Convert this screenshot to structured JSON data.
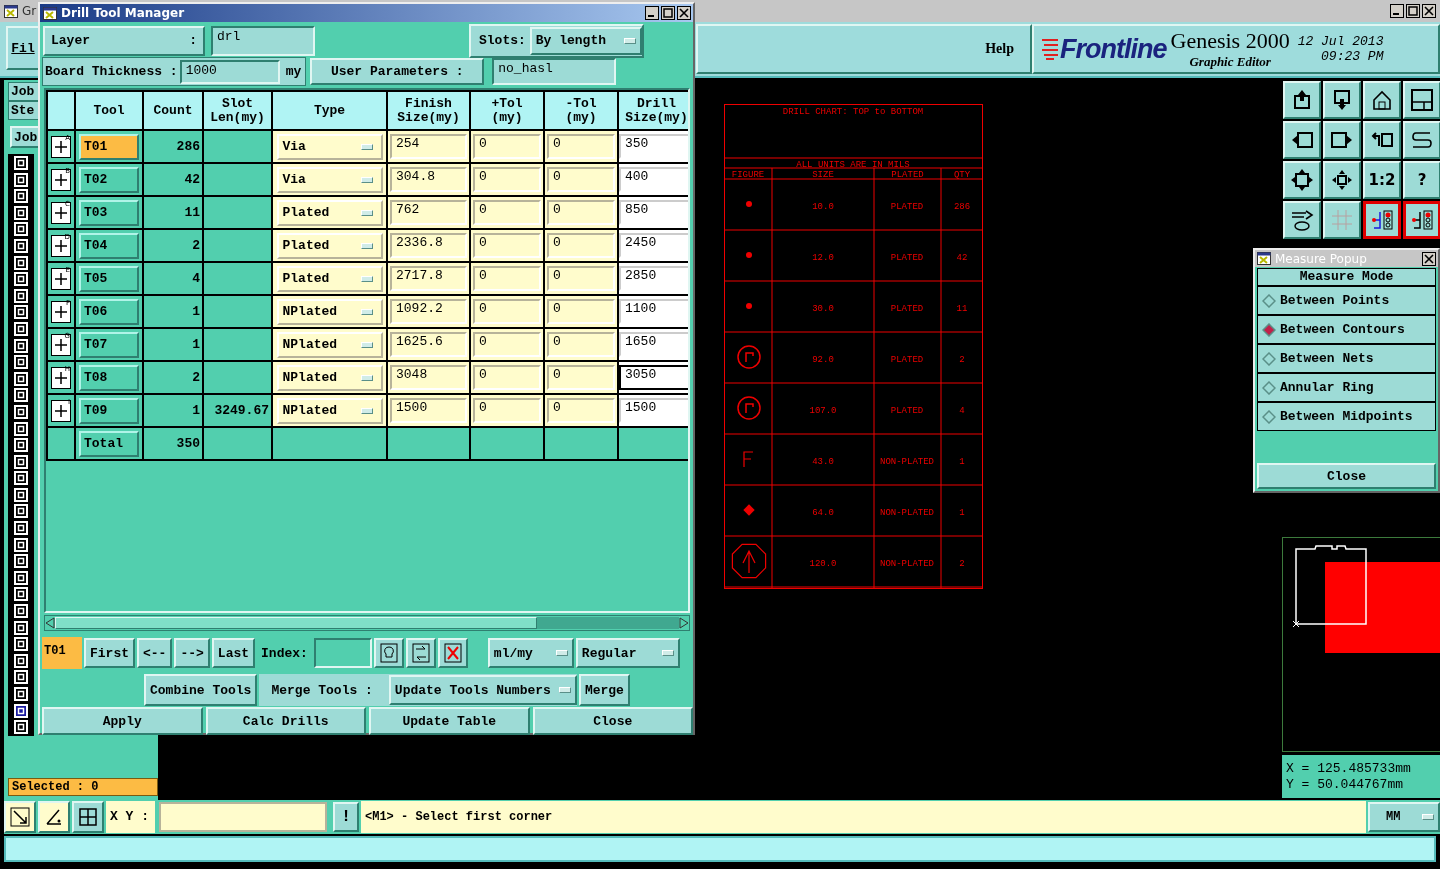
{
  "app": {
    "window_title": "Gr",
    "menu": [
      {
        "label": "Fil"
      }
    ],
    "side_tabs": [
      {
        "label": "Job"
      },
      {
        "label": "Ste"
      }
    ],
    "side_button": "Job",
    "help": "Help",
    "logo": "Frontline",
    "product": "Genesis 2000",
    "subtitle": "Graphic Editor",
    "date": "12 Jul 2013",
    "time": "09:23 PM",
    "selected_count": "Selected : 0",
    "xy_label": "X Y :",
    "alert_button": "!",
    "message": "<M1> - Select first corner",
    "units": "MM",
    "coords": [
      "X = 125.485733mm",
      "Y = 50.044767mm"
    ]
  },
  "tool_column": [
    {
      "selected": false
    },
    {
      "selected": false
    },
    {
      "selected": false
    },
    {
      "selected": false
    },
    {
      "selected": false
    },
    {
      "selected": false
    },
    {
      "selected": false
    },
    {
      "selected": false
    },
    {
      "selected": false
    },
    {
      "selected": false
    },
    {
      "selected": false
    },
    {
      "selected": false
    },
    {
      "selected": false
    },
    {
      "selected": false
    },
    {
      "selected": false
    },
    {
      "selected": false
    },
    {
      "selected": false
    },
    {
      "selected": false
    },
    {
      "selected": false
    },
    {
      "selected": false
    },
    {
      "selected": false
    },
    {
      "selected": false
    },
    {
      "selected": false
    },
    {
      "selected": false
    },
    {
      "selected": false
    },
    {
      "selected": false
    },
    {
      "selected": false
    },
    {
      "selected": false
    },
    {
      "selected": false
    },
    {
      "selected": false
    },
    {
      "selected": false
    },
    {
      "selected": false
    },
    {
      "selected": false
    },
    {
      "selected": true
    },
    {
      "selected": false
    }
  ],
  "toolbar": [
    {
      "on": false
    },
    {
      "on": false
    },
    {
      "on": false
    },
    {
      "on": false
    },
    {
      "on": false
    },
    {
      "on": false
    },
    {
      "on": false
    },
    {
      "on": false
    },
    {
      "on": false
    },
    {
      "on": false
    },
    {
      "on": false,
      "label": "1:2"
    },
    {
      "on": false,
      "label": "?"
    },
    {
      "on": false
    },
    {
      "on": false
    },
    {
      "on": true
    },
    {
      "on": true
    }
  ],
  "drill_chart": {
    "title": "DRILL CHART: TOP to BOTTOM",
    "note": "ALL UNITS ARE IN MILS",
    "columns": [
      "FIGURE",
      "SIZE",
      "PLATED",
      "QTY"
    ],
    "rows": [
      {
        "kind": "dot",
        "size": "10.0",
        "plated": "PLATED",
        "qty": "286"
      },
      {
        "kind": "dot",
        "size": "12.0",
        "plated": "PLATED",
        "qty": "42"
      },
      {
        "kind": "dot",
        "size": "30.0",
        "plated": "PLATED",
        "qty": "11"
      },
      {
        "kind": "circle_r",
        "size": "92.0",
        "plated": "PLATED",
        "qty": "2"
      },
      {
        "kind": "circle_r",
        "size": "107.0",
        "plated": "PLATED",
        "qty": "4"
      },
      {
        "kind": "f_mark",
        "size": "43.0",
        "plated": "NON-PLATED",
        "qty": "1"
      },
      {
        "kind": "pad_mark",
        "size": "64.0",
        "plated": "NON-PLATED",
        "qty": "1"
      },
      {
        "kind": "arrow_octagon",
        "size": "120.0",
        "plated": "NON-PLATED",
        "qty": "2"
      }
    ]
  },
  "drill_tool_manager": {
    "title": "Drill Tool Manager",
    "layer_label": "Layer",
    "layer_colon": ":",
    "layer": "drl",
    "slots_label": "Slots:",
    "slots": "By length",
    "thickness_label": "Board Thickness :",
    "thickness": "1000",
    "thickness_unit": "my",
    "user_params_label": "User Parameters :",
    "user_params": "no_hasl",
    "columns": [
      "Tool",
      "Count",
      "Slot\nLen(my)",
      "Type",
      "Finish\nSize(my)",
      "+Tol\n(my)",
      "-Tol\n(my)",
      "Drill\nSize(my)"
    ],
    "rows": [
      {
        "letter": "A",
        "tool": "T01",
        "selected": true,
        "count": "286",
        "type": "Via",
        "finish": "254",
        "plus_tol": "0",
        "minus_tol": "0",
        "drill": "350",
        "focused": false
      },
      {
        "letter": "B",
        "tool": "T02",
        "selected": false,
        "count": "42",
        "type": "Via",
        "finish": "304.8",
        "plus_tol": "0",
        "minus_tol": "0",
        "drill": "400",
        "focused": false
      },
      {
        "letter": "C",
        "tool": "T03",
        "selected": false,
        "count": "11",
        "type": "Plated",
        "finish": "762",
        "plus_tol": "0",
        "minus_tol": "0",
        "drill": "850",
        "focused": false
      },
      {
        "letter": "D",
        "tool": "T04",
        "selected": false,
        "count": "2",
        "type": "Plated",
        "finish": "2336.8",
        "plus_tol": "0",
        "minus_tol": "0",
        "drill": "2450",
        "focused": false
      },
      {
        "letter": "E",
        "tool": "T05",
        "selected": false,
        "count": "4",
        "type": "Plated",
        "finish": "2717.8",
        "plus_tol": "0",
        "minus_tol": "0",
        "drill": "2850",
        "focused": false
      },
      {
        "letter": "F",
        "tool": "T06",
        "selected": false,
        "count": "1",
        "type": "NPlated",
        "finish": "1092.2",
        "plus_tol": "0",
        "minus_tol": "0",
        "drill": "1100",
        "focused": false
      },
      {
        "letter": "G",
        "tool": "T07",
        "selected": false,
        "count": "1",
        "type": "NPlated",
        "finish": "1625.6",
        "plus_tol": "0",
        "minus_tol": "0",
        "drill": "1650",
        "focused": false
      },
      {
        "letter": "H",
        "tool": "T08",
        "selected": false,
        "count": "2",
        "type": "NPlated",
        "finish": "3048",
        "plus_tol": "0",
        "minus_tol": "0",
        "drill": "3050",
        "focused": true
      },
      {
        "letter": "I",
        "tool": "T09",
        "selected": false,
        "count": "1",
        "slot_len": "3249.67",
        "type": "NPlated",
        "finish": "1500",
        "plus_tol": "0",
        "minus_tol": "0",
        "drill": "1500",
        "focused": false
      }
    ],
    "total_label": "Total",
    "total_count": "350",
    "current_tool": "T01",
    "nav_buttons": [
      "First",
      "<--",
      "-->",
      "Last"
    ],
    "index_label": "Index:",
    "unit_mode": "ml/my",
    "drill_mode": "Regular",
    "combine": "Combine Tools",
    "merge_label": "Merge Tools :",
    "merge_mode": "Update Tools Numbers",
    "merge": "Merge",
    "actions": [
      "Apply",
      "Calc Drills",
      "Update Table",
      "Close"
    ]
  },
  "measure_popup": {
    "title": "Measure Popup",
    "heading": "Measure Mode",
    "options": [
      {
        "label": "Between Points",
        "selected": false
      },
      {
        "label": "Between Contours",
        "selected": true
      },
      {
        "label": "Between Nets",
        "selected": false
      },
      {
        "label": "Annular Ring",
        "selected": false
      },
      {
        "label": "Between Midpoints",
        "selected": false
      }
    ],
    "close": "Close"
  }
}
